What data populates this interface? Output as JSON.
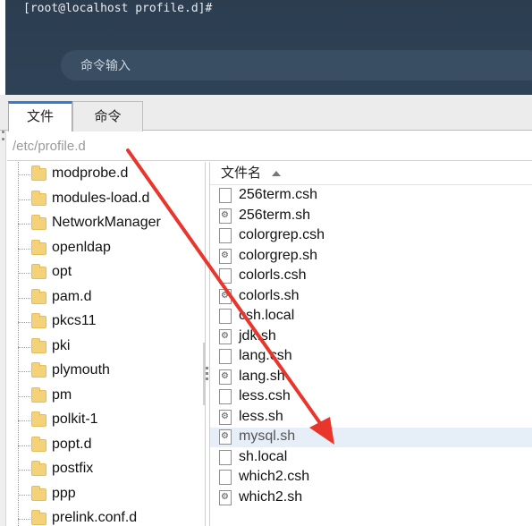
{
  "terminal": {
    "prompt": "[root@localhost profile.d]#",
    "input_placeholder": "命令输入"
  },
  "tabs": [
    {
      "label": "文件",
      "active": true
    },
    {
      "label": "命令",
      "active": false
    }
  ],
  "path": "/etc/profile.d",
  "tree": {
    "items": [
      "modprobe.d",
      "modules-load.d",
      "NetworkManager",
      "openldap",
      "opt",
      "pam.d",
      "pkcs11",
      "pki",
      "plymouth",
      "pm",
      "polkit-1",
      "popt.d",
      "postfix",
      "ppp",
      "prelink.conf.d"
    ]
  },
  "files": {
    "column_header": "文件名",
    "items": [
      {
        "name": "256term.csh",
        "icon": "file-icon"
      },
      {
        "name": "256term.sh",
        "icon": "script-icon"
      },
      {
        "name": "colorgrep.csh",
        "icon": "file-icon"
      },
      {
        "name": "colorgrep.sh",
        "icon": "script-icon"
      },
      {
        "name": "colorls.csh",
        "icon": "file-icon"
      },
      {
        "name": "colorls.sh",
        "icon": "script-icon"
      },
      {
        "name": "csh.local",
        "icon": "file-icon"
      },
      {
        "name": "jdk.sh",
        "icon": "script-icon"
      },
      {
        "name": "lang.csh",
        "icon": "file-icon"
      },
      {
        "name": "lang.sh",
        "icon": "script-icon"
      },
      {
        "name": "less.csh",
        "icon": "file-icon"
      },
      {
        "name": "less.sh",
        "icon": "script-icon"
      },
      {
        "name": "mysql.sh",
        "icon": "script-icon",
        "selected": true
      },
      {
        "name": "sh.local",
        "icon": "file-icon"
      },
      {
        "name": "which2.csh",
        "icon": "file-icon"
      },
      {
        "name": "which2.sh",
        "icon": "script-icon"
      }
    ]
  },
  "colors": {
    "terminal_bg": "#2e4257",
    "active_tab_accent": "#2f7bd9",
    "annotation_arrow": "#e8362d",
    "selected_row": "#e6eef8"
  }
}
